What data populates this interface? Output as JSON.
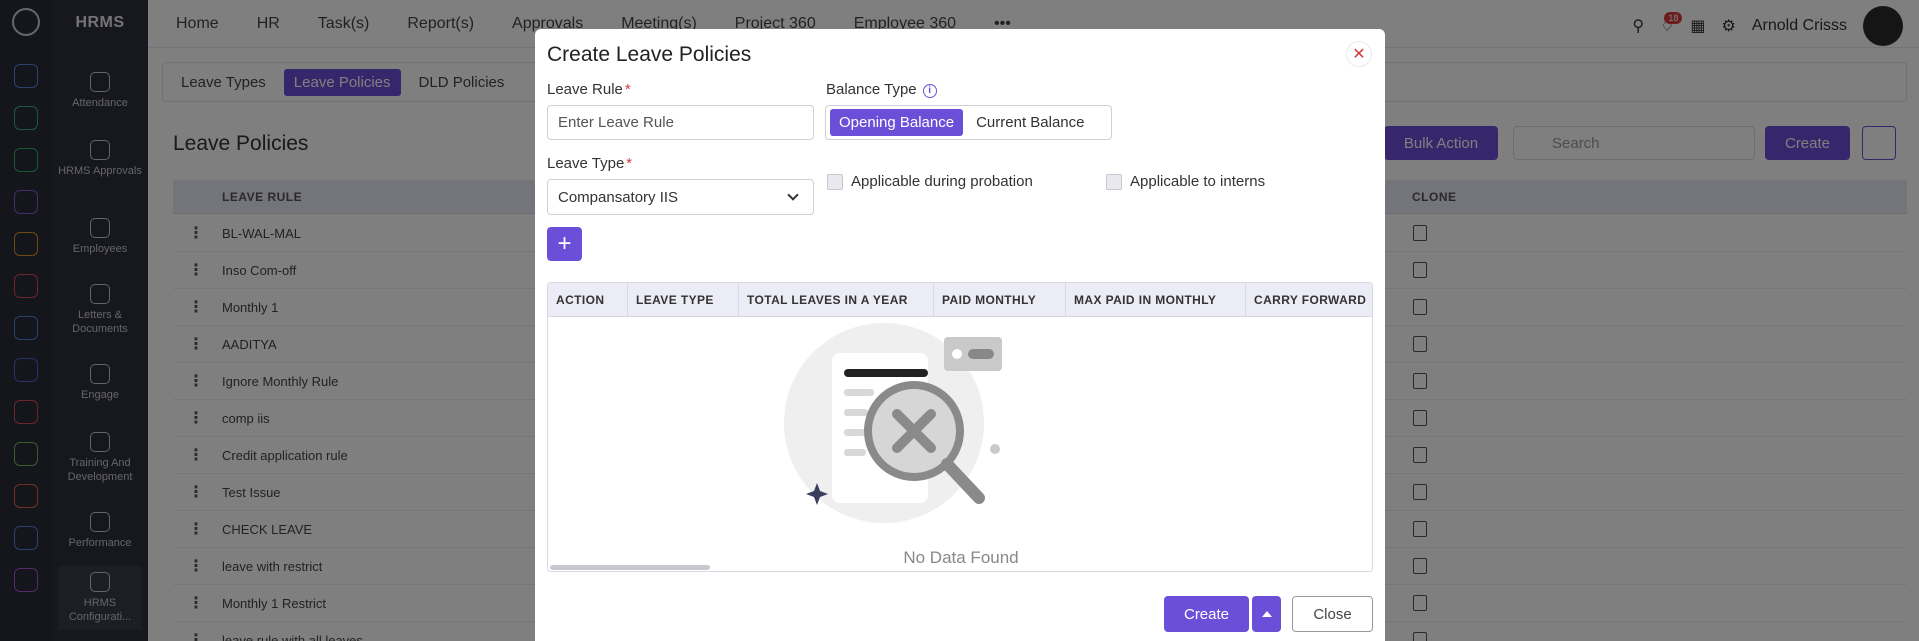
{
  "app": {
    "brand": "HRMS",
    "nav_items": [
      "Attendance",
      "HRMS Approvals",
      "Employees",
      "Letters & Documents",
      "Engage",
      "Training And Development",
      "Performance",
      "HRMS Configurati..."
    ],
    "top_menu": [
      "Home",
      "HR",
      "Task(s)",
      "Report(s)",
      "Approvals",
      "Meeting(s)",
      "Project 360",
      "Employee 360"
    ],
    "notification_count": "18",
    "user_name": "Arnold Crisss",
    "subtabs": [
      "Leave Types",
      "Leave Policies",
      "DLD Policies"
    ],
    "page_title": "Leave Policies",
    "bulk_action_label": "Bulk Action",
    "search_placeholder": "Search",
    "create_label": "Create",
    "table_columns": {
      "rule": "LEAVE RULE",
      "clone": "CLONE"
    },
    "rows": [
      "BL-WAL-MAL",
      "Inso Com-off",
      "Monthly 1",
      "AADITYA",
      "Ignore Monthly Rule",
      "comp iis",
      "Credit application rule",
      "Test Issue",
      "CHECK LEAVE",
      "leave with restrict",
      "Monthly 1 Restrict",
      "leave rule with all leaves"
    ]
  },
  "modal": {
    "title": "Create Leave Policies",
    "close_icon": "close-icon",
    "leave_rule_label": "Leave Rule",
    "leave_rule_placeholder": "Enter Leave Rule",
    "balance_type_label": "Balance Type",
    "balance_options": [
      "Opening Balance",
      "Current Balance"
    ],
    "leave_type_label": "Leave Type",
    "leave_type_value": "Compansatory IIS",
    "checkbox_probation": "Applicable during probation",
    "checkbox_interns": "Applicable to interns",
    "columns": [
      "ACTION",
      "LEAVE TYPE",
      "TOTAL LEAVES IN A YEAR",
      "PAID MONTHLY",
      "MAX PAID IN MONTHLY",
      "CARRY FORWARD"
    ],
    "empty_text": "No Data Found",
    "create_label": "Create",
    "close_label": "Close",
    "accent_color": "#6c4fd8"
  }
}
